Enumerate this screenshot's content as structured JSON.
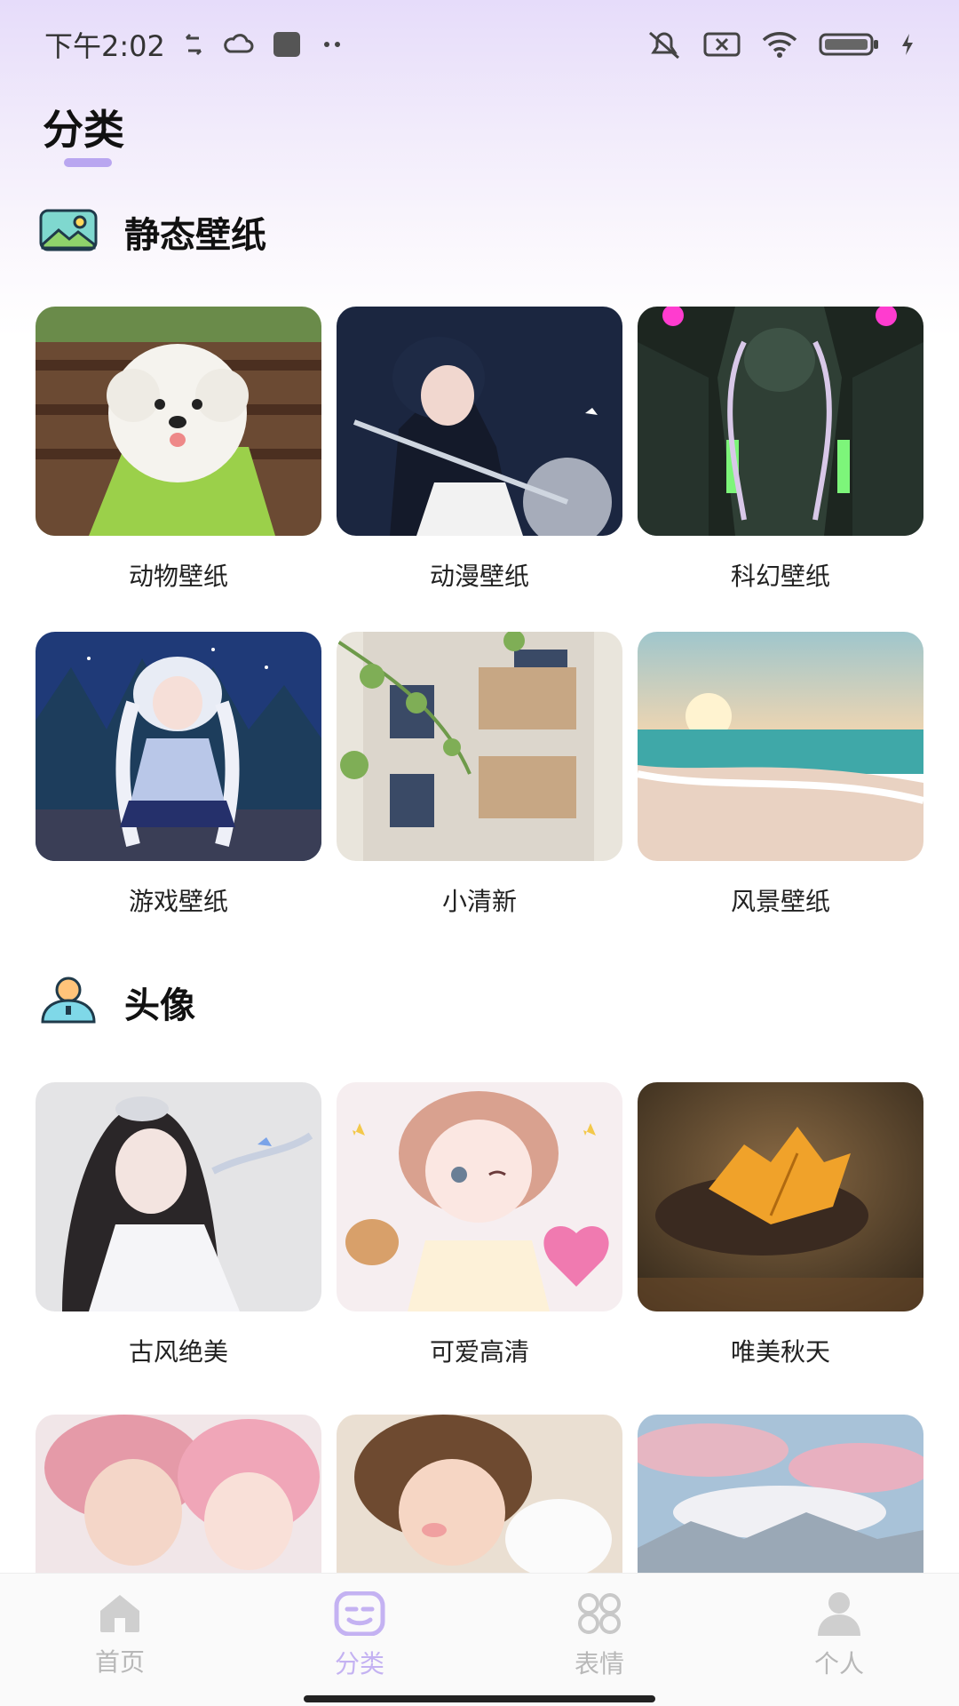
{
  "status_bar": {
    "time": "下午2:02",
    "battery_icon": "battery-icon",
    "wifi_icon": "wifi-icon"
  },
  "page": {
    "title": "分类"
  },
  "sections": {
    "static_wallpaper": {
      "label": "静态壁纸",
      "icon": "image-icon",
      "items": [
        {
          "label": "动物壁纸"
        },
        {
          "label": "动漫壁纸"
        },
        {
          "label": "科幻壁纸"
        },
        {
          "label": "游戏壁纸"
        },
        {
          "label": "小清新"
        },
        {
          "label": "风景壁纸"
        }
      ]
    },
    "avatar": {
      "label": "头像",
      "icon": "person-icon",
      "items": [
        {
          "label": "古风绝美"
        },
        {
          "label": "可爱高清"
        },
        {
          "label": "唯美秋天"
        }
      ]
    }
  },
  "tabbar": {
    "items": [
      {
        "label": "首页",
        "icon": "home-icon",
        "active": false
      },
      {
        "label": "分类",
        "icon": "category-icon",
        "active": true
      },
      {
        "label": "表情",
        "icon": "emoji-grid-icon",
        "active": false
      },
      {
        "label": "个人",
        "icon": "person-icon",
        "active": false
      }
    ]
  },
  "colors": {
    "accent": "#c4b2f2",
    "inactive": "#b8b8b8",
    "header_gradient": "#e6dcfa"
  }
}
